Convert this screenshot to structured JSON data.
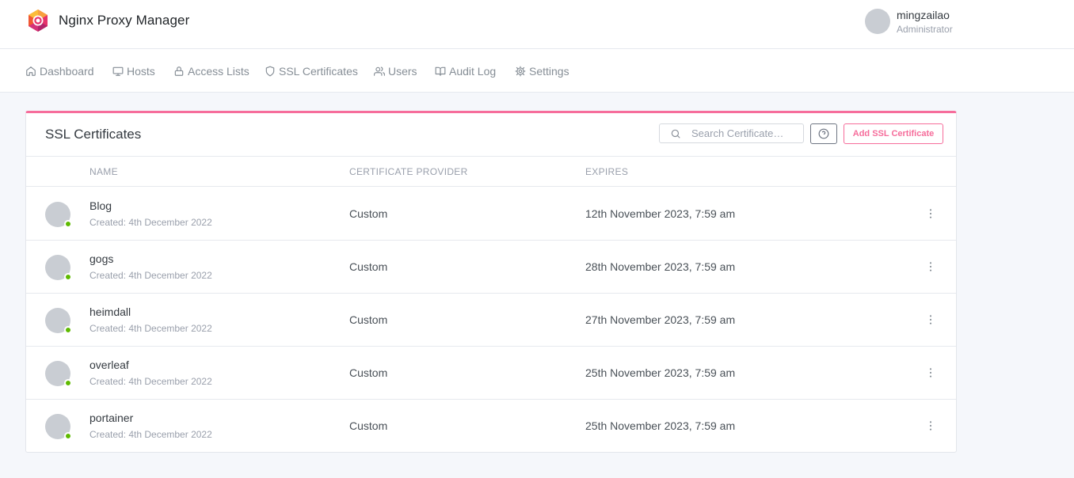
{
  "app": {
    "title": "Nginx Proxy Manager"
  },
  "user": {
    "name": "mingzailao",
    "role": "Administrator"
  },
  "nav": {
    "items": [
      {
        "label": "Dashboard",
        "icon": "home-icon"
      },
      {
        "label": "Hosts",
        "icon": "monitor-icon"
      },
      {
        "label": "Access Lists",
        "icon": "lock-icon"
      },
      {
        "label": "SSL Certificates",
        "icon": "shield-icon"
      },
      {
        "label": "Users",
        "icon": "users-icon"
      },
      {
        "label": "Audit Log",
        "icon": "book-icon"
      },
      {
        "label": "Settings",
        "icon": "gear-icon"
      }
    ]
  },
  "card": {
    "title": "SSL Certificates",
    "search_placeholder": "Search Certificate…",
    "add_button": "Add SSL Certificate",
    "accent_color": "#f66d9b"
  },
  "table": {
    "columns": [
      "NAME",
      "CERTIFICATE PROVIDER",
      "EXPIRES"
    ],
    "rows": [
      {
        "name": "Blog",
        "created": "Created: 4th December 2022",
        "provider": "Custom",
        "expires": "12th November 2023, 7:59 am"
      },
      {
        "name": "gogs",
        "created": "Created: 4th December 2022",
        "provider": "Custom",
        "expires": "28th November 2023, 7:59 am"
      },
      {
        "name": "heimdall",
        "created": "Created: 4th December 2022",
        "provider": "Custom",
        "expires": "27th November 2023, 7:59 am"
      },
      {
        "name": "overleaf",
        "created": "Created: 4th December 2022",
        "provider": "Custom",
        "expires": "25th November 2023, 7:59 am"
      },
      {
        "name": "portainer",
        "created": "Created: 4th December 2022",
        "provider": "Custom",
        "expires": "25th November 2023, 7:59 am"
      }
    ],
    "status_color": "#5eba00"
  }
}
